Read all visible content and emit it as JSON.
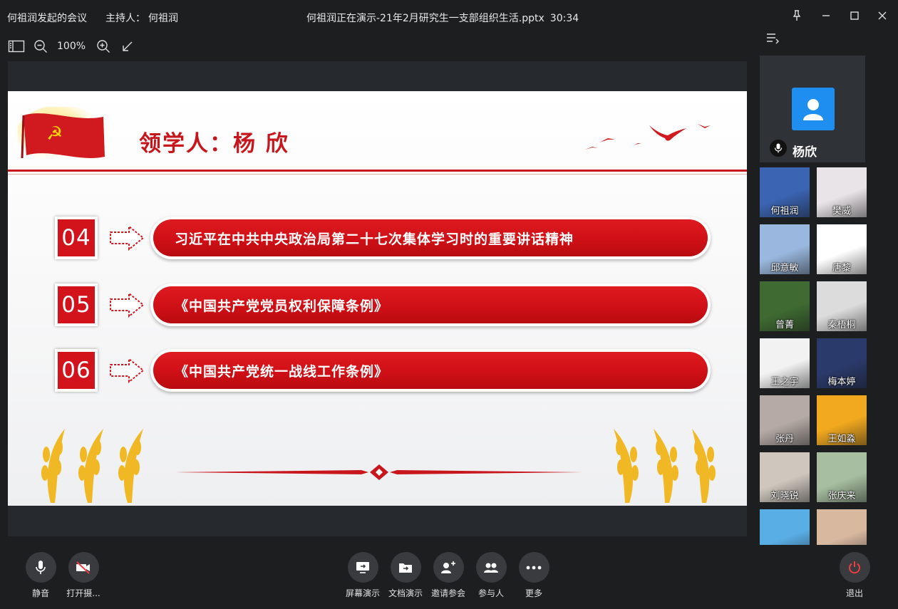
{
  "title_bar": {
    "meeting_name": "何祖润发起的会议",
    "host_label": "主持人：",
    "host_name": "何祖润",
    "presentation_status": "何祖润正在演示-21年2月研究生一支部组织生活.pptx",
    "elapsed_time": "30:34"
  },
  "toolbar": {
    "zoom_level": "100%"
  },
  "slide": {
    "title": "领学人：杨 欣",
    "items": [
      {
        "number": "04",
        "text": "习近平在中共中央政治局第二十七次集体学习时的重要讲话精神"
      },
      {
        "number": "05",
        "text": "《中国共产党党员权利保障条例》"
      },
      {
        "number": "06",
        "text": "《中国共产党统一战线工作条例》"
      }
    ]
  },
  "active_speaker": {
    "name": "杨欣"
  },
  "participants": [
    {
      "name": "何祖润",
      "bg": "#3b64b3"
    },
    {
      "name": "樊威",
      "bg": "#e9e4e7"
    },
    {
      "name": "邱意敏",
      "bg": "#9ab8df"
    },
    {
      "name": "唐黎",
      "bg": "#ffffff"
    },
    {
      "name": "曾菁",
      "bg": "#3f6b32"
    },
    {
      "name": "秦梧桐",
      "bg": "#dcdcdc"
    },
    {
      "name": "王之宇",
      "bg": "#f2f2f2"
    },
    {
      "name": "梅本婷",
      "bg": "#2a3a6a"
    },
    {
      "name": "张丹",
      "bg": "#b5aaa5"
    },
    {
      "name": "王如淼",
      "bg": "#f2a81f"
    },
    {
      "name": "刘晓锐",
      "bg": "#cfc7bd"
    },
    {
      "name": "张庆来",
      "bg": "#a7bfa0"
    },
    {
      "name": "",
      "bg": "#5aaee6"
    },
    {
      "name": "",
      "bg": "#d9b8a0"
    }
  ],
  "controls": {
    "mute": "静音",
    "camera": "打开摄...",
    "screen_share": "屏幕演示",
    "doc_share": "文档演示",
    "invite": "邀请参会",
    "participants": "参与人",
    "more": "更多",
    "leave": "退出"
  },
  "colors": {
    "accent_red": "#c8161d",
    "leave_red": "#ef3c42",
    "avatar_blue": "#1e8ff0"
  }
}
